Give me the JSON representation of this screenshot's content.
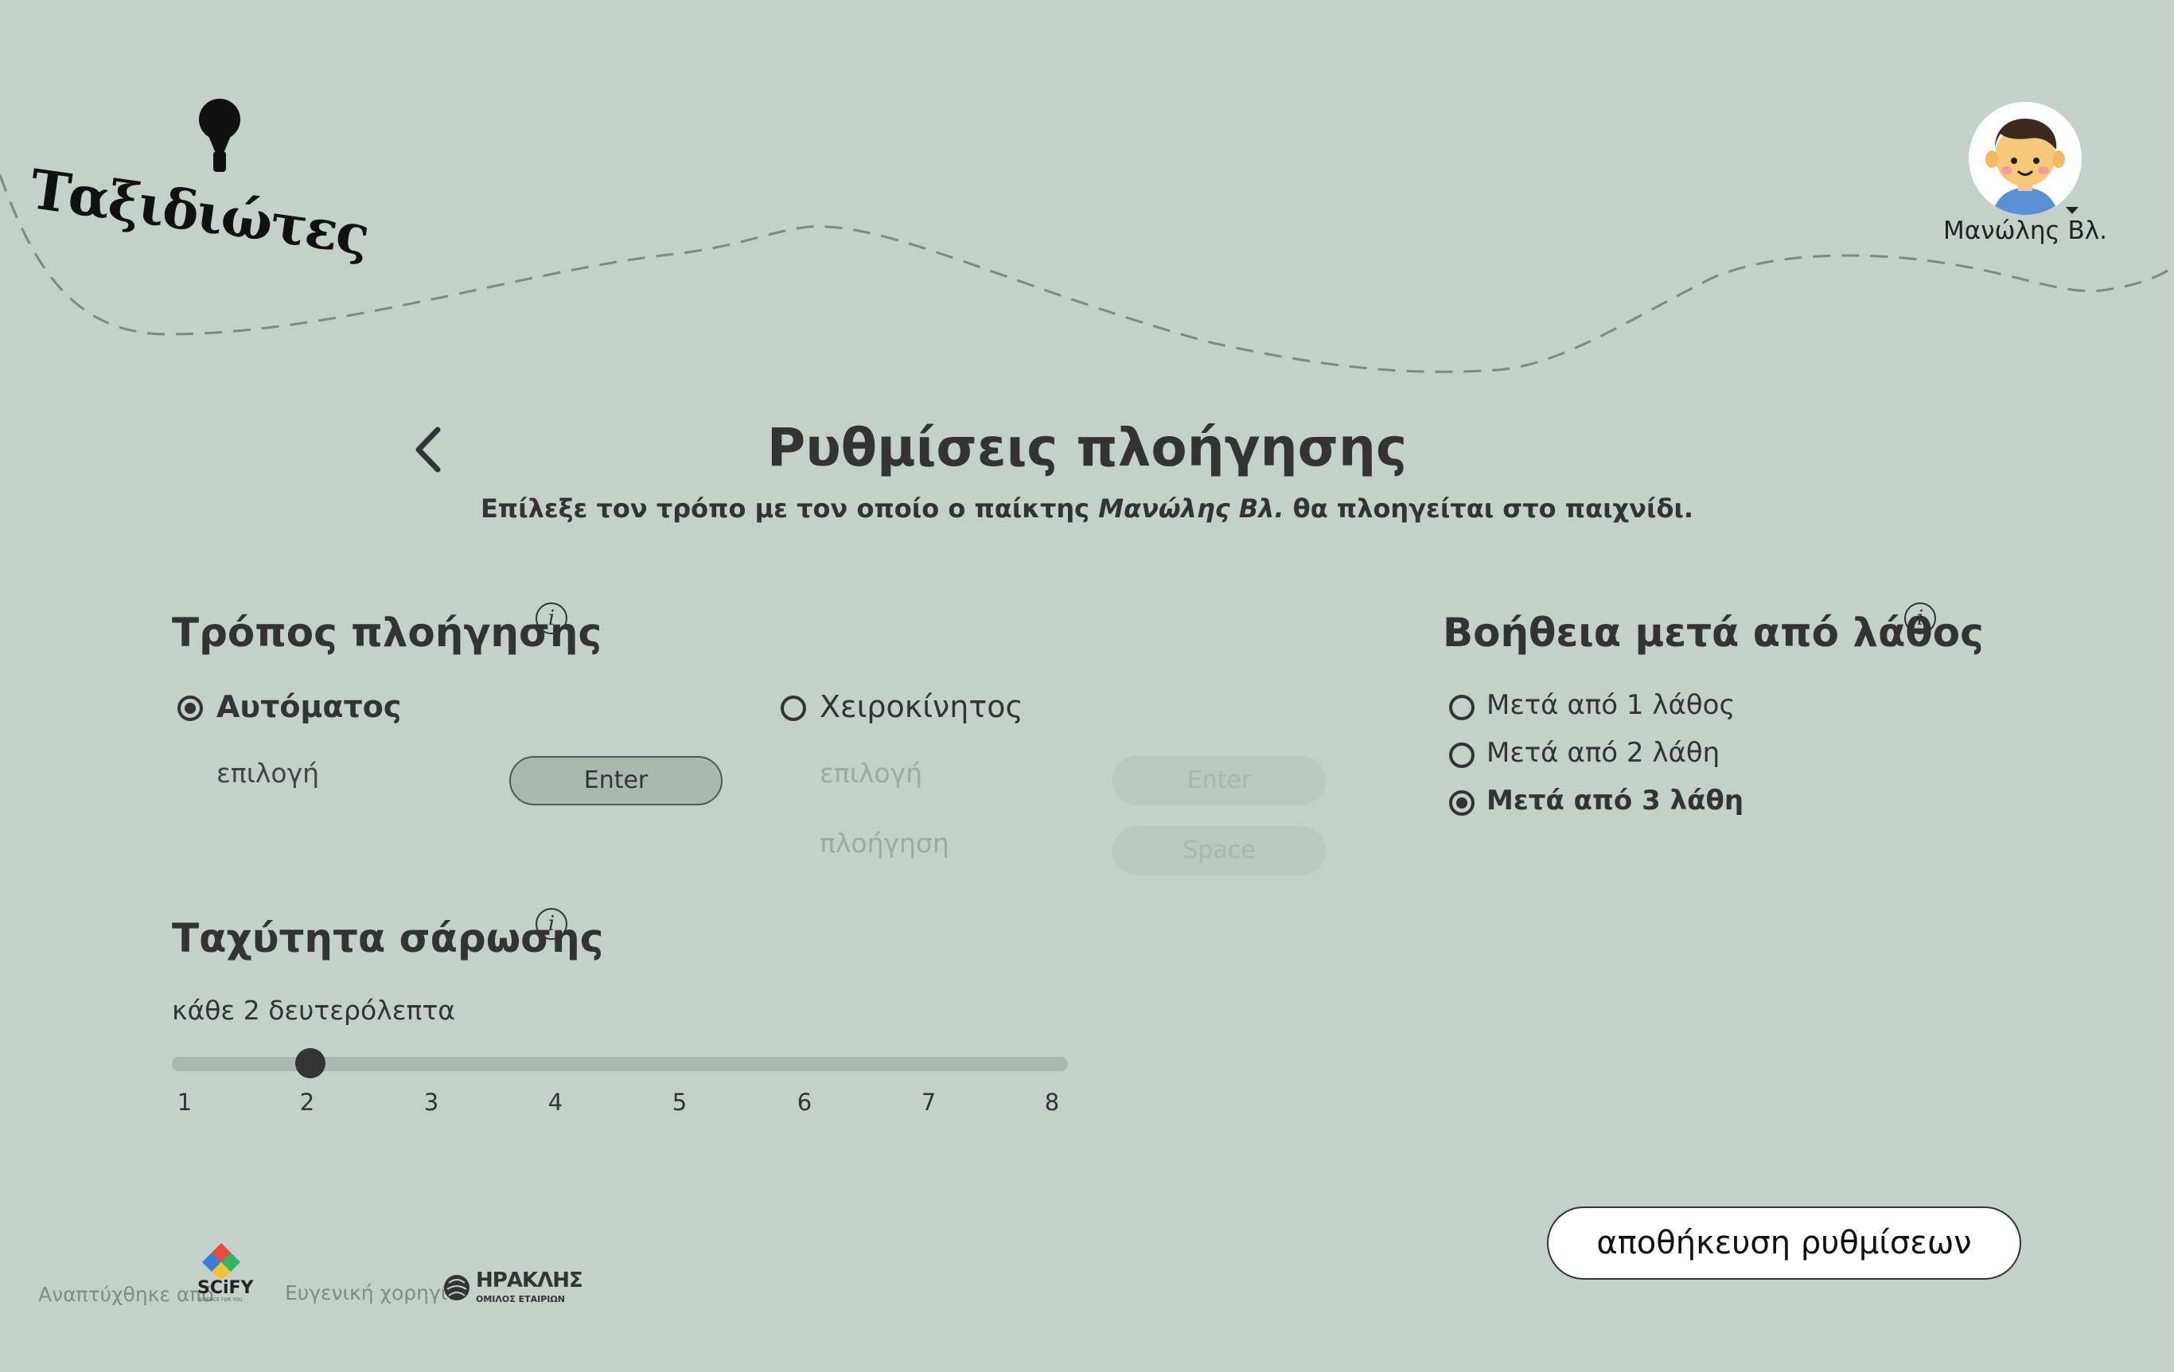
{
  "app": {
    "logo_text": "Ταξιδιώτες"
  },
  "user": {
    "name": "Μανώλης Βλ."
  },
  "page": {
    "title": "Ρυθμίσεις πλοήγησης",
    "subtitle_pre": "Επίλεξε τον τρόπο με τον οποίο ο παίκτης ",
    "subtitle_player": "Μανώλης Βλ.",
    "subtitle_post": " θα πλοηγείται στο παιχνίδι."
  },
  "navigation": {
    "heading": "Τρόπος πλοήγησης",
    "automatic": {
      "label": "Αυτόματος",
      "selected": true,
      "select_label": "επιλογή",
      "select_key": "Enter"
    },
    "manual": {
      "label": "Χειροκίνητος",
      "selected": false,
      "select_label": "επιλογή",
      "select_key": "Enter",
      "nav_label": "πλοήγηση",
      "nav_key": "Space"
    }
  },
  "scan_speed": {
    "heading": "Ταχύτητα σάρωσης",
    "value_text": "κάθε 2 δευτερόλεπτα",
    "value": 2,
    "ticks": [
      "1",
      "2",
      "3",
      "4",
      "5",
      "6",
      "7",
      "8"
    ]
  },
  "help": {
    "heading": "Βοήθεια μετά από λάθος",
    "options": [
      {
        "label": "Μετά από 1 λάθος",
        "selected": false
      },
      {
        "label": "Μετά από 2 λάθη",
        "selected": false
      },
      {
        "label": "Μετά από 3 λάθη",
        "selected": true
      }
    ]
  },
  "save_button": "αποθήκευση ρυθμίσεων",
  "footer": {
    "developed_by": "Αναπτύχθηκε από",
    "developer_logo": "SCiFY",
    "developer_tagline": "SCIENCE FOR YOU",
    "sponsor": "Ευγενική χορηγία",
    "sponsor_logo": "ΗΡΑΚΛΗΣ",
    "sponsor_tagline": "ΟΜΙΛΟΣ ΕΤΑΙΡΙΩΝ"
  },
  "icons": {
    "logo": "hot-air-balloon-icon",
    "back": "chevron-left-icon",
    "info": "info-icon",
    "user": "avatar-icon",
    "caret": "caret-down-icon"
  },
  "colors": {
    "background": "#c3d1ca",
    "text": "#333333",
    "path": "#7c8a84",
    "slider_track": "#a9b8b0"
  }
}
